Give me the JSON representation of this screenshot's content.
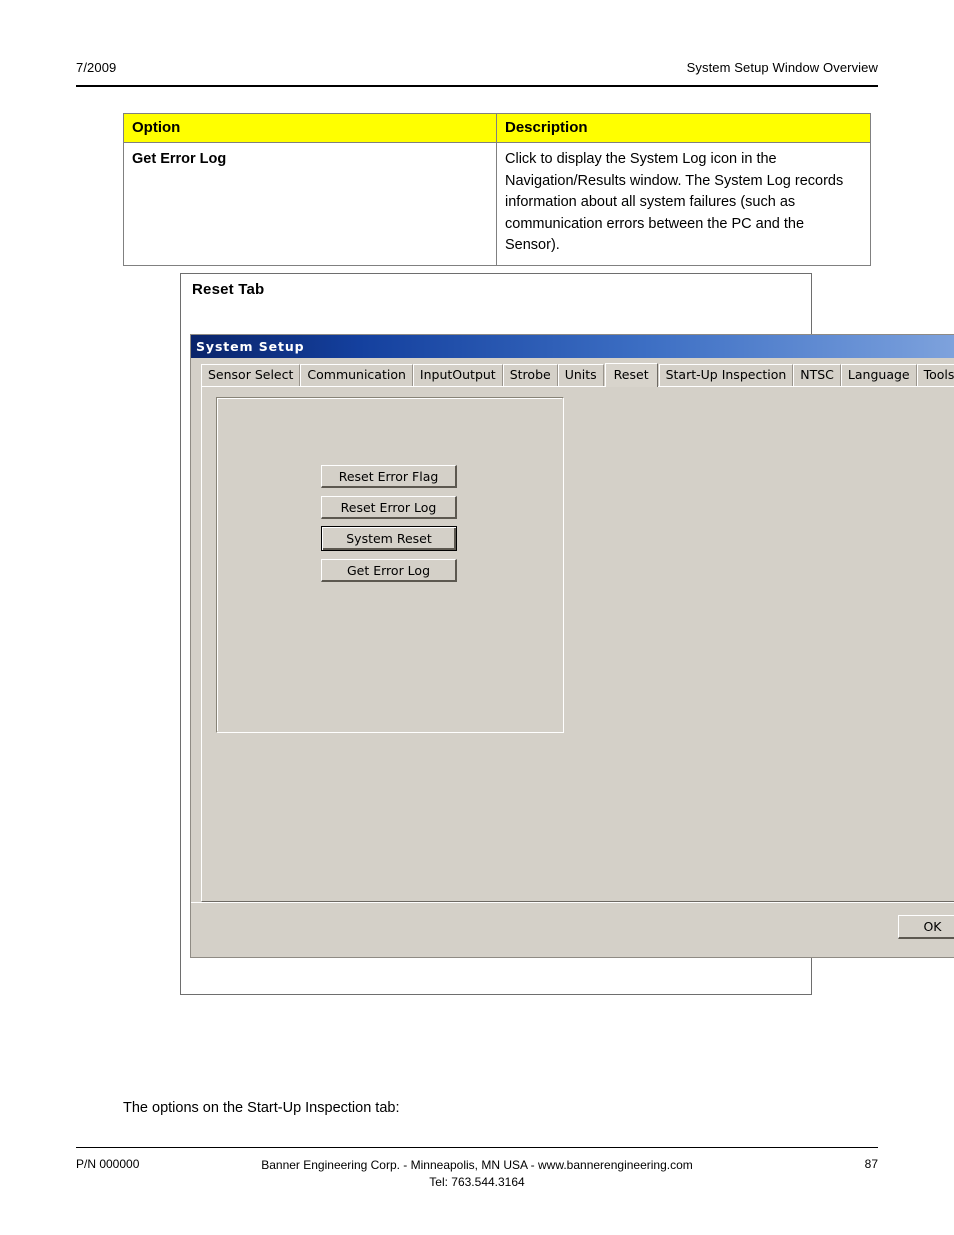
{
  "page": {
    "header_left": "7/2009",
    "header_right": "System Setup Window Overview",
    "body_note": "The options on the Start-Up Inspection tab:",
    "footer_part_number": "P/N 000000",
    "footer_company_line1": "Banner Engineering Corp. - Minneapolis, MN USA - www.bannerengineering.com",
    "footer_company_line2": "Tel: 763.544.3164",
    "footer_page_number": "87",
    "highlight_color": "#ffff00"
  },
  "options_table": {
    "headers": [
      "Option",
      "Description"
    ],
    "rows": [
      {
        "option": "Get Error Log",
        "description": "Click to display the System Log icon in the Navigation/Results window. The System Log records information about all system failures (such as communication errors between the PC and the Sensor)."
      }
    ]
  },
  "figure": {
    "caption": "Reset Tab"
  },
  "dialog": {
    "title": "System Setup",
    "titlebar_color_start": "#0a246a",
    "titlebar_color_end": "#7ea2dc",
    "face_color": "#d4d0c8",
    "tabs": [
      {
        "label": "Sensor Select",
        "active": false
      },
      {
        "label": "Communication",
        "active": false
      },
      {
        "label": "InputOutput",
        "active": false
      },
      {
        "label": "Strobe",
        "active": false
      },
      {
        "label": "Units",
        "active": false
      },
      {
        "label": "Reset",
        "active": true
      },
      {
        "label": "Start-Up Inspection",
        "active": false
      },
      {
        "label": "NTSC",
        "active": false
      },
      {
        "label": "Language",
        "active": false
      },
      {
        "label": "Tools Configurat",
        "active": false
      }
    ],
    "reset_panel": {
      "buttons": [
        {
          "label": "Reset Error Flag",
          "default": false
        },
        {
          "label": "Reset Error Log",
          "default": false
        },
        {
          "label": "System Reset",
          "default": true
        },
        {
          "label": "Get Error Log",
          "default": false
        }
      ]
    },
    "footer": {
      "ok_label": "OK"
    }
  }
}
